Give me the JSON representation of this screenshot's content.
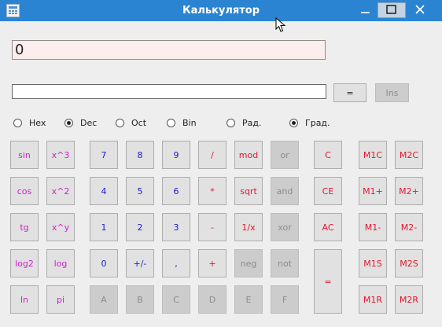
{
  "window": {
    "title": "Калькулятор",
    "minimize_glyph": "–",
    "maximize_glyph": "☐",
    "close_glyph": "✕"
  },
  "display": {
    "value": "0"
  },
  "input": {
    "value": ""
  },
  "equals_top": "=",
  "ins": "Ins",
  "radios": [
    {
      "label": "Hex",
      "checked": false
    },
    {
      "label": "Dec",
      "checked": true
    },
    {
      "label": "Oct",
      "checked": false
    },
    {
      "label": "Bin",
      "checked": false
    },
    {
      "label": "Рад.",
      "checked": false
    },
    {
      "label": "Град.",
      "checked": true
    }
  ],
  "buttons": {
    "sin": "sin",
    "x3": "x^3",
    "cos": "cos",
    "x2": "x^2",
    "tg": "tg",
    "xy": "x^y",
    "log2": "log2",
    "log": "log",
    "ln": "ln",
    "pi": "pi",
    "d7": "7",
    "d8": "8",
    "d9": "9",
    "d4": "4",
    "d5": "5",
    "d6": "6",
    "d1": "1",
    "d2": "2",
    "d3": "3",
    "d0": "0",
    "plusminus": "+/-",
    "comma": ",",
    "A": "A",
    "B": "B",
    "C_hex": "C",
    "D": "D",
    "E": "E",
    "F": "F",
    "div": "/",
    "mod": "mod",
    "or": "or",
    "mul": "*",
    "sqrt": "sqrt",
    "and": "and",
    "minus": "-",
    "inv": "1/x",
    "xor": "xor",
    "plus": "+",
    "neg": "neg",
    "not": "not",
    "clear": "C",
    "ce": "CE",
    "ac": "AC",
    "equals": "=",
    "m1c": "M1C",
    "m2c": "M2C",
    "m1plus": "M1+",
    "m2plus": "M2+",
    "m1minus": "M1-",
    "m2minus": "M2-",
    "m1s": "M1S",
    "m2s": "M2S",
    "m1r": "M1R",
    "m2r": "M2R"
  },
  "colors": {
    "titlebar": "#2b84d2",
    "function_text": "#d11ecd",
    "digit_text": "#1b1bd4",
    "operator_text": "#e0182e",
    "display_bg": "#fdeeee"
  }
}
